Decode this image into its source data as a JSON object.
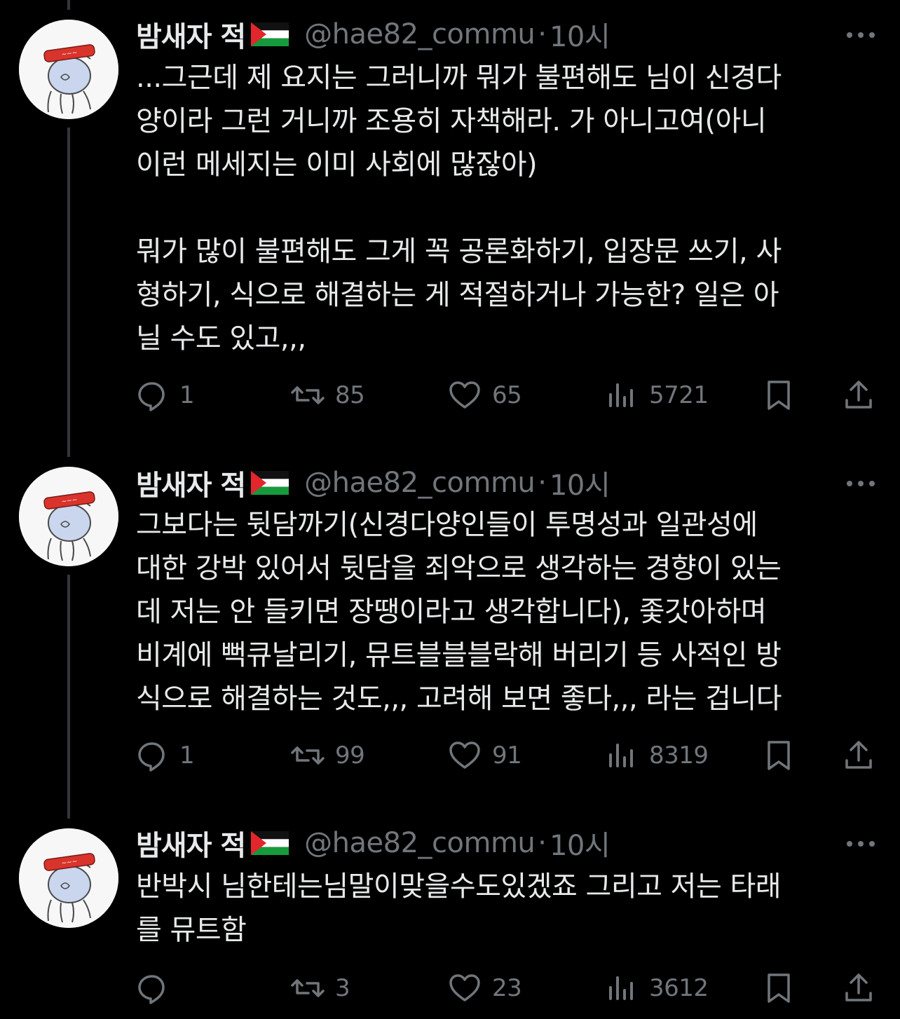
{
  "colors": {
    "background": "#000000",
    "primary_text": "#e7e9ea",
    "secondary_text": "#71767b",
    "thread_line": "#333639"
  },
  "tweets": [
    {
      "display_name": "밤새자 적",
      "flag_icon": "palestine-flag",
      "handle": "@hae82_commu",
      "separator": "·",
      "time": "10시",
      "text": "...그근데 제 요지는 그러니까 뭐가 불편해도 님이 신경다\n양이라 그런 거니까 조용히 자책해라. 가 아니고여(아니\n이런 메세지는 이미 사회에 많잖아)\n\n뭐가 많이 불편해도 그게 꼭 공론화하기, 입장문 쓰기, 사\n형하기, 식으로 해결하는 게 적절하거나 가능한? 일은 아\n닐 수도 있고,,,",
      "replies": "1",
      "retweets": "85",
      "likes": "65",
      "views": "5721"
    },
    {
      "display_name": "밤새자 적",
      "flag_icon": "palestine-flag",
      "handle": "@hae82_commu",
      "separator": "·",
      "time": "10시",
      "text": "그보다는 뒷담까기(신경다양인들이 투명성과 일관성에\n대한 강박 있어서 뒷담을 죄악으로 생각하는 경향이 있는\n데 저는 안 들키면 장땡이라고 생각합니다), 좇갓아하며\n비계에 뻑큐날리기, 뮤트블블블락해 버리기 등 사적인 방\n식으로 해결하는 것도,,, 고려해 보면 좋다,,, 라는 겁니다",
      "replies": "1",
      "retweets": "99",
      "likes": "91",
      "views": "8319"
    },
    {
      "display_name": "밤새자 적",
      "flag_icon": "palestine-flag",
      "handle": "@hae82_commu",
      "separator": "·",
      "time": "10시",
      "text": "반박시 님한테는님말이맞을수도있겠죠 그리고 저는 타래\n를 뮤트함",
      "replies": "",
      "retweets": "3",
      "likes": "23",
      "views": "3612"
    }
  ]
}
